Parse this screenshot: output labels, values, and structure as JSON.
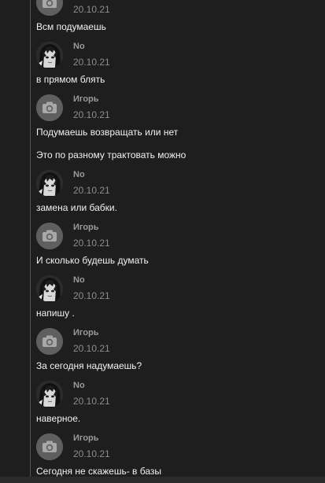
{
  "chat": {
    "messages": [
      {
        "author": "",
        "date": "20.10.21",
        "avatar": "camera-icon",
        "lines": [
          "Всм подумаешь"
        ]
      },
      {
        "author": "No",
        "date": "20.10.21",
        "avatar": "anime-avatar",
        "lines": [
          "в прямом блять"
        ]
      },
      {
        "author": "Игорь",
        "date": "20.10.21",
        "avatar": "camera-icon",
        "lines": [
          "Подумаешь возвращать или нет",
          "Это по разному трактовать можно"
        ]
      },
      {
        "author": "No",
        "date": "20.10.21",
        "avatar": "anime-avatar",
        "lines": [
          "замена или бабки."
        ]
      },
      {
        "author": "Игорь",
        "date": "20.10.21",
        "avatar": "camera-icon",
        "lines": [
          "И сколько будешь думать"
        ]
      },
      {
        "author": "No",
        "date": "20.10.21",
        "avatar": "anime-avatar",
        "lines": [
          "напишу ."
        ]
      },
      {
        "author": "Игорь",
        "date": "20.10.21",
        "avatar": "camera-icon",
        "lines": [
          "За сегодня надумаешь?"
        ]
      },
      {
        "author": "No",
        "date": "20.10.21",
        "avatar": "anime-avatar",
        "lines": [
          "наверное."
        ]
      },
      {
        "author": "Игорь",
        "date": "20.10.21",
        "avatar": "camera-icon",
        "lines": [
          "Сегодня не скажешь- в базы"
        ]
      }
    ]
  },
  "colors": {
    "background": "#1e1e1e",
    "author": "#9a9a9a",
    "date": "#8d8d8d",
    "message": "#f2f2f2"
  }
}
